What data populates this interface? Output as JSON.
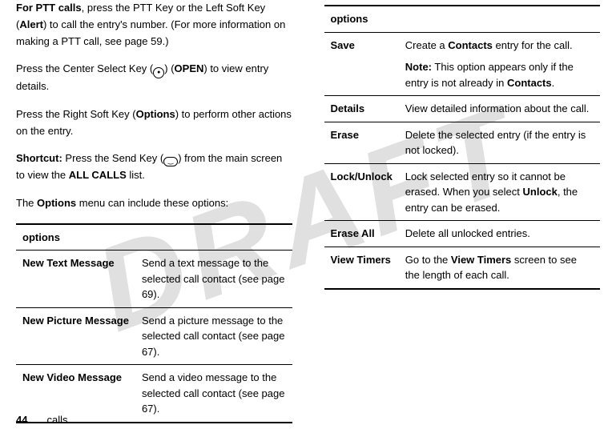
{
  "watermark": "DRAFT",
  "left": {
    "p1_bold": "For PTT calls",
    "p1_rest_a": ", press the PTT Key or the Left Soft Key (",
    "p1_alert": "Alert",
    "p1_rest_b": ") to call the entry's number. (For more information on making a PTT call, see page 59.)",
    "p2_a": "Press the Center Select Key (",
    "p2_open": "OPEN",
    "p2_b": ") to view entry details.",
    "p3_a": "Press the Right Soft Key (",
    "p3_options": "Options",
    "p3_b": ") to perform other actions on the entry.",
    "p4_bold": "Shortcut:",
    "p4_a": " Press the Send Key (",
    "p4_b": ") from the main screen to view the ",
    "p4_allcalls": "ALL CALLS",
    "p4_c": " list.",
    "p5_a": "The ",
    "p5_options": "Options",
    "p5_b": " menu can include these options:",
    "table1": {
      "header": "options",
      "rows": [
        {
          "k": "New Text Message",
          "v": "Send a text message to the selected call contact (see page 69)."
        },
        {
          "k": "New Picture Message",
          "v": "Send a picture message to the selected call contact (see page 67)."
        },
        {
          "k": "New Video Message",
          "v": "Send a video message to the selected call contact (see page 67)."
        }
      ]
    }
  },
  "right": {
    "table2": {
      "header": "options",
      "rows": [
        {
          "k": "Save",
          "v": "Create a ",
          "v_cond": "Contacts",
          "v2": " entry for the call.",
          "note_bold": "Note:",
          "note_a": " This option appears only if the entry is not already in ",
          "note_cond": "Contacts",
          "note_b": "."
        },
        {
          "k": "Details",
          "v": "View detailed information about the call."
        },
        {
          "k": "Erase",
          "v": "Delete the selected entry (if the entry is not locked)."
        },
        {
          "k": "Lock/Unlock",
          "v": "Lock selected entry so it cannot be erased. When you select ",
          "v_cond": "Unlock",
          "v2": ", the entry can be erased."
        },
        {
          "k": "Erase All",
          "v": "Delete all unlocked entries."
        },
        {
          "k": "View Timers",
          "v": "Go to the ",
          "v_cond": "View Timers",
          "v2": " screen to see the length of each call."
        }
      ]
    }
  },
  "footer": {
    "page": "44",
    "section": "calls"
  },
  "icons": {
    "center": "●",
    "send": "⏝"
  }
}
